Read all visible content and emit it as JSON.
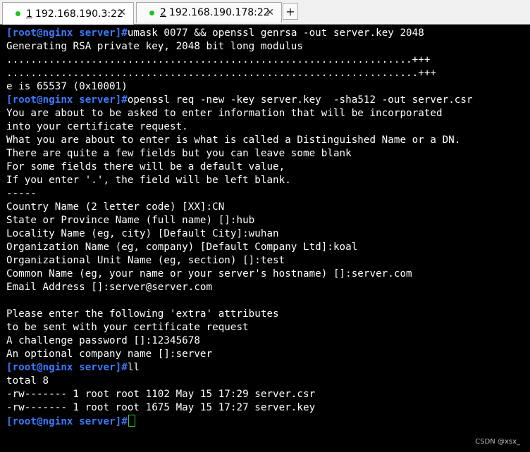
{
  "tabs": [
    {
      "num": "1",
      "label": "192.168.190.3:22",
      "close": "✕",
      "status_color": "#1ec21e"
    },
    {
      "num": "2",
      "label": "192.168.190.178:22",
      "close": "✕",
      "status_color": "#1ec21e"
    }
  ],
  "add_tab_label": "+",
  "colors": {
    "prompt": "#3b7bff",
    "text": "#ffffff",
    "background": "#000000",
    "cursor": "#2fd02f"
  },
  "terminal": {
    "lines": [
      {
        "prompt": "[root@nginx server]#",
        "text": "umask 0077 && openssl genrsa -out server.key 2048"
      },
      {
        "prompt": "",
        "text": "Generating RSA private key, 2048 bit long modulus"
      },
      {
        "prompt": "",
        "text": "...................................................................+++"
      },
      {
        "prompt": "",
        "text": "....................................................................+++"
      },
      {
        "prompt": "",
        "text": "e is 65537 (0x10001)"
      },
      {
        "prompt": "[root@nginx server]#",
        "text": "openssl req -new -key server.key  -sha512 -out server.csr"
      },
      {
        "prompt": "",
        "text": "You are about to be asked to enter information that will be incorporated"
      },
      {
        "prompt": "",
        "text": "into your certificate request."
      },
      {
        "prompt": "",
        "text": "What you are about to enter is what is called a Distinguished Name or a DN."
      },
      {
        "prompt": "",
        "text": "There are quite a few fields but you can leave some blank"
      },
      {
        "prompt": "",
        "text": "For some fields there will be a default value,"
      },
      {
        "prompt": "",
        "text": "If you enter '.', the field will be left blank."
      },
      {
        "prompt": "",
        "text": "-----"
      },
      {
        "prompt": "",
        "text": "Country Name (2 letter code) [XX]:CN"
      },
      {
        "prompt": "",
        "text": "State or Province Name (full name) []:hub"
      },
      {
        "prompt": "",
        "text": "Locality Name (eg, city) [Default City]:wuhan"
      },
      {
        "prompt": "",
        "text": "Organization Name (eg, company) [Default Company Ltd]:koal"
      },
      {
        "prompt": "",
        "text": "Organizational Unit Name (eg, section) []:test"
      },
      {
        "prompt": "",
        "text": "Common Name (eg, your name or your server's hostname) []:server.com"
      },
      {
        "prompt": "",
        "text": "Email Address []:server@server.com"
      },
      {
        "prompt": "",
        "text": ""
      },
      {
        "prompt": "",
        "text": "Please enter the following 'extra' attributes"
      },
      {
        "prompt": "",
        "text": "to be sent with your certificate request"
      },
      {
        "prompt": "",
        "text": "A challenge password []:12345678"
      },
      {
        "prompt": "",
        "text": "An optional company name []:server"
      },
      {
        "prompt": "[root@nginx server]#",
        "text": "ll"
      },
      {
        "prompt": "",
        "text": "total 8"
      },
      {
        "prompt": "",
        "text": "-rw------- 1 root root 1102 May 15 17:29 server.csr"
      },
      {
        "prompt": "",
        "text": "-rw------- 1 root root 1675 May 15 17:27 server.key"
      },
      {
        "prompt": "[root@nginx server]#",
        "text": ""
      }
    ]
  },
  "watermark": "CSDN @xsx_"
}
